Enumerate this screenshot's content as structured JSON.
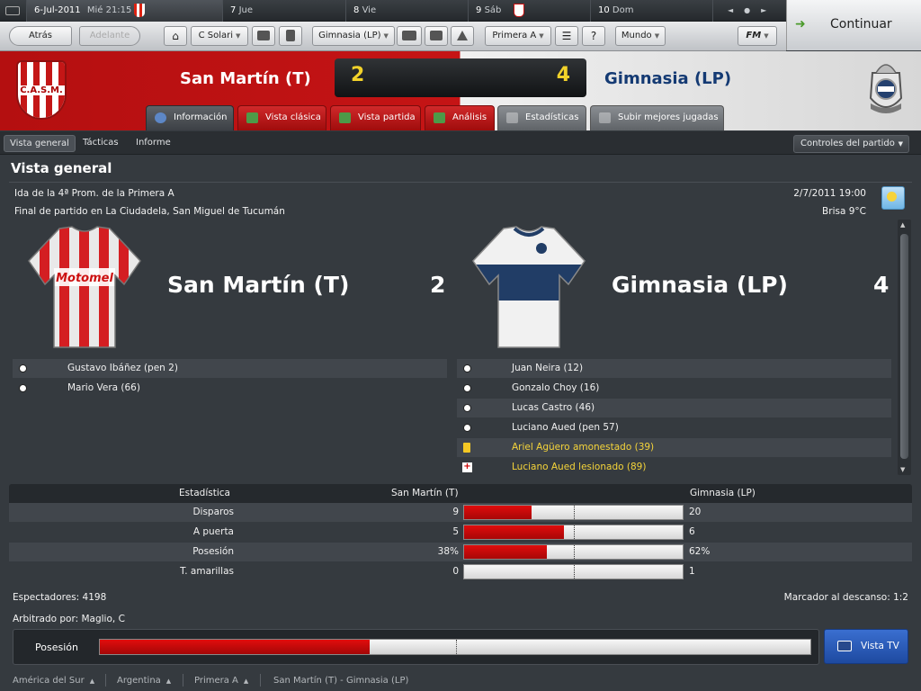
{
  "calendar": {
    "today_date": "6-Jul-2011",
    "today_day": "Mié 21:15",
    "days": [
      {
        "num": "7",
        "label": "Jue"
      },
      {
        "num": "8",
        "label": "Vie"
      },
      {
        "num": "9",
        "label": "Sáb"
      },
      {
        "num": "10",
        "label": "Dom"
      }
    ]
  },
  "continue_label": "Continuar",
  "nav": {
    "back": "Atrás",
    "forward": "Adelante",
    "manager": "C Solari",
    "club": "Gimnasia (LP)",
    "competition": "Primera A",
    "world": "Mundo",
    "fm": "FM"
  },
  "match": {
    "home_name": "San Martín (T)",
    "away_name": "Gimnasia (LP)",
    "home_score": "2",
    "away_score": "4",
    "home_crest_text": "C.A.S.M."
  },
  "header_tabs": [
    {
      "label": "Información",
      "icon": "info-icon"
    },
    {
      "label": "Vista clásica",
      "icon": "pitch-icon"
    },
    {
      "label": "Vista partida",
      "icon": "split-pitch-icon"
    },
    {
      "label": "Análisis",
      "icon": "analysis-icon"
    },
    {
      "label": "Estadísticas",
      "icon": "stats-icon"
    },
    {
      "label": "Subir mejores jugadas",
      "icon": "upload-icon"
    }
  ],
  "sub_tabs": [
    "Vista general",
    "Tácticas",
    "Informe"
  ],
  "match_controls": "Controles del partido",
  "page_title": "Vista general",
  "info": {
    "competition": "Ida de la 4ª Prom. de la Primera A",
    "venue": "Final de partido en La Ciudadela, San Miguel de Tucumán",
    "datetime": "2/7/2011 19:00",
    "weather": "Brisa 9°C"
  },
  "shirt_sponsor": "Motomel",
  "home_events": [
    {
      "type": "goal",
      "text": "Gustavo Ibáñez (pen 2)"
    },
    {
      "type": "goal",
      "text": "Mario Vera (66)"
    }
  ],
  "away_events": [
    {
      "type": "goal",
      "text": "Juan Neira (12)"
    },
    {
      "type": "goal",
      "text": "Gonzalo Choy (16)"
    },
    {
      "type": "goal",
      "text": "Lucas Castro (46)"
    },
    {
      "type": "goal",
      "text": "Luciano Aued (pen 57)"
    },
    {
      "type": "yellow",
      "text": "Ariel Agüero amonestado (39)"
    },
    {
      "type": "injury",
      "text": "Luciano Aued lesionado (89)"
    }
  ],
  "stats_header": {
    "stat": "Estadística",
    "home": "San Martín (T)",
    "away": "Gimnasia (LP)"
  },
  "stats": [
    {
      "label": "Disparos",
      "home": "9",
      "away": "20",
      "home_share": 0.31
    },
    {
      "label": "A puerta",
      "home": "5",
      "away": "6",
      "home_share": 0.455
    },
    {
      "label": "Posesión",
      "home": "38%",
      "away": "62%",
      "home_share": 0.38
    },
    {
      "label": "T. amarillas",
      "home": "0",
      "away": "1",
      "home_share": 0.0
    }
  ],
  "footer": {
    "attendance": "Espectadores: 4198",
    "referee": "Arbitrado por: Maglio, C",
    "halftime": "Marcador al descanso: 1:2"
  },
  "possession_bar": {
    "label": "Posesión",
    "home_share": 0.38
  },
  "tv_button": "Vista TV",
  "breadcrumb": [
    "América del Sur",
    "Argentina",
    "Primera A",
    "San Martín (T) - Gimnasia (LP)"
  ],
  "colors": {
    "home": "#c51415",
    "away_text": "#143a73",
    "score": "#f2d22a",
    "tv": "#2a5cbb"
  }
}
